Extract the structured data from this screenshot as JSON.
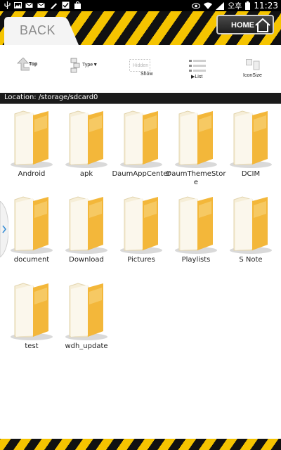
{
  "status_bar": {
    "time": "11:23",
    "ampm": "오후",
    "icons": [
      "usb-icon",
      "image-icon",
      "mail-icon",
      "mail-icon",
      "pencil-icon",
      "check-icon",
      "shopping-bag-icon",
      "eye-icon",
      "wifi-icon",
      "signal-icon",
      "battery-icon"
    ]
  },
  "header": {
    "back_label": "BACK",
    "home_label": "HOME"
  },
  "toolbar": {
    "top_label": "Top",
    "type_label": "Type",
    "hidden_label": "Hidden",
    "show_label": "Show",
    "list_label": "List",
    "iconsize_label": "IconSize"
  },
  "location": {
    "text": "Location: /storage/sdcard0"
  },
  "folders": [
    {
      "label": "Android"
    },
    {
      "label": "apk"
    },
    {
      "label": "DaumAppCenter"
    },
    {
      "label": "DaumThemeStore"
    },
    {
      "label": "DCIM"
    },
    {
      "label": "document"
    },
    {
      "label": "Download"
    },
    {
      "label": "Pictures"
    },
    {
      "label": "Playlists"
    },
    {
      "label": "S Note"
    },
    {
      "label": "test"
    },
    {
      "label": "wdh_update"
    }
  ],
  "colors": {
    "hazard_yellow": "#f5c400",
    "hazard_black": "#111111",
    "folder_yellow": "#f3b73a"
  }
}
